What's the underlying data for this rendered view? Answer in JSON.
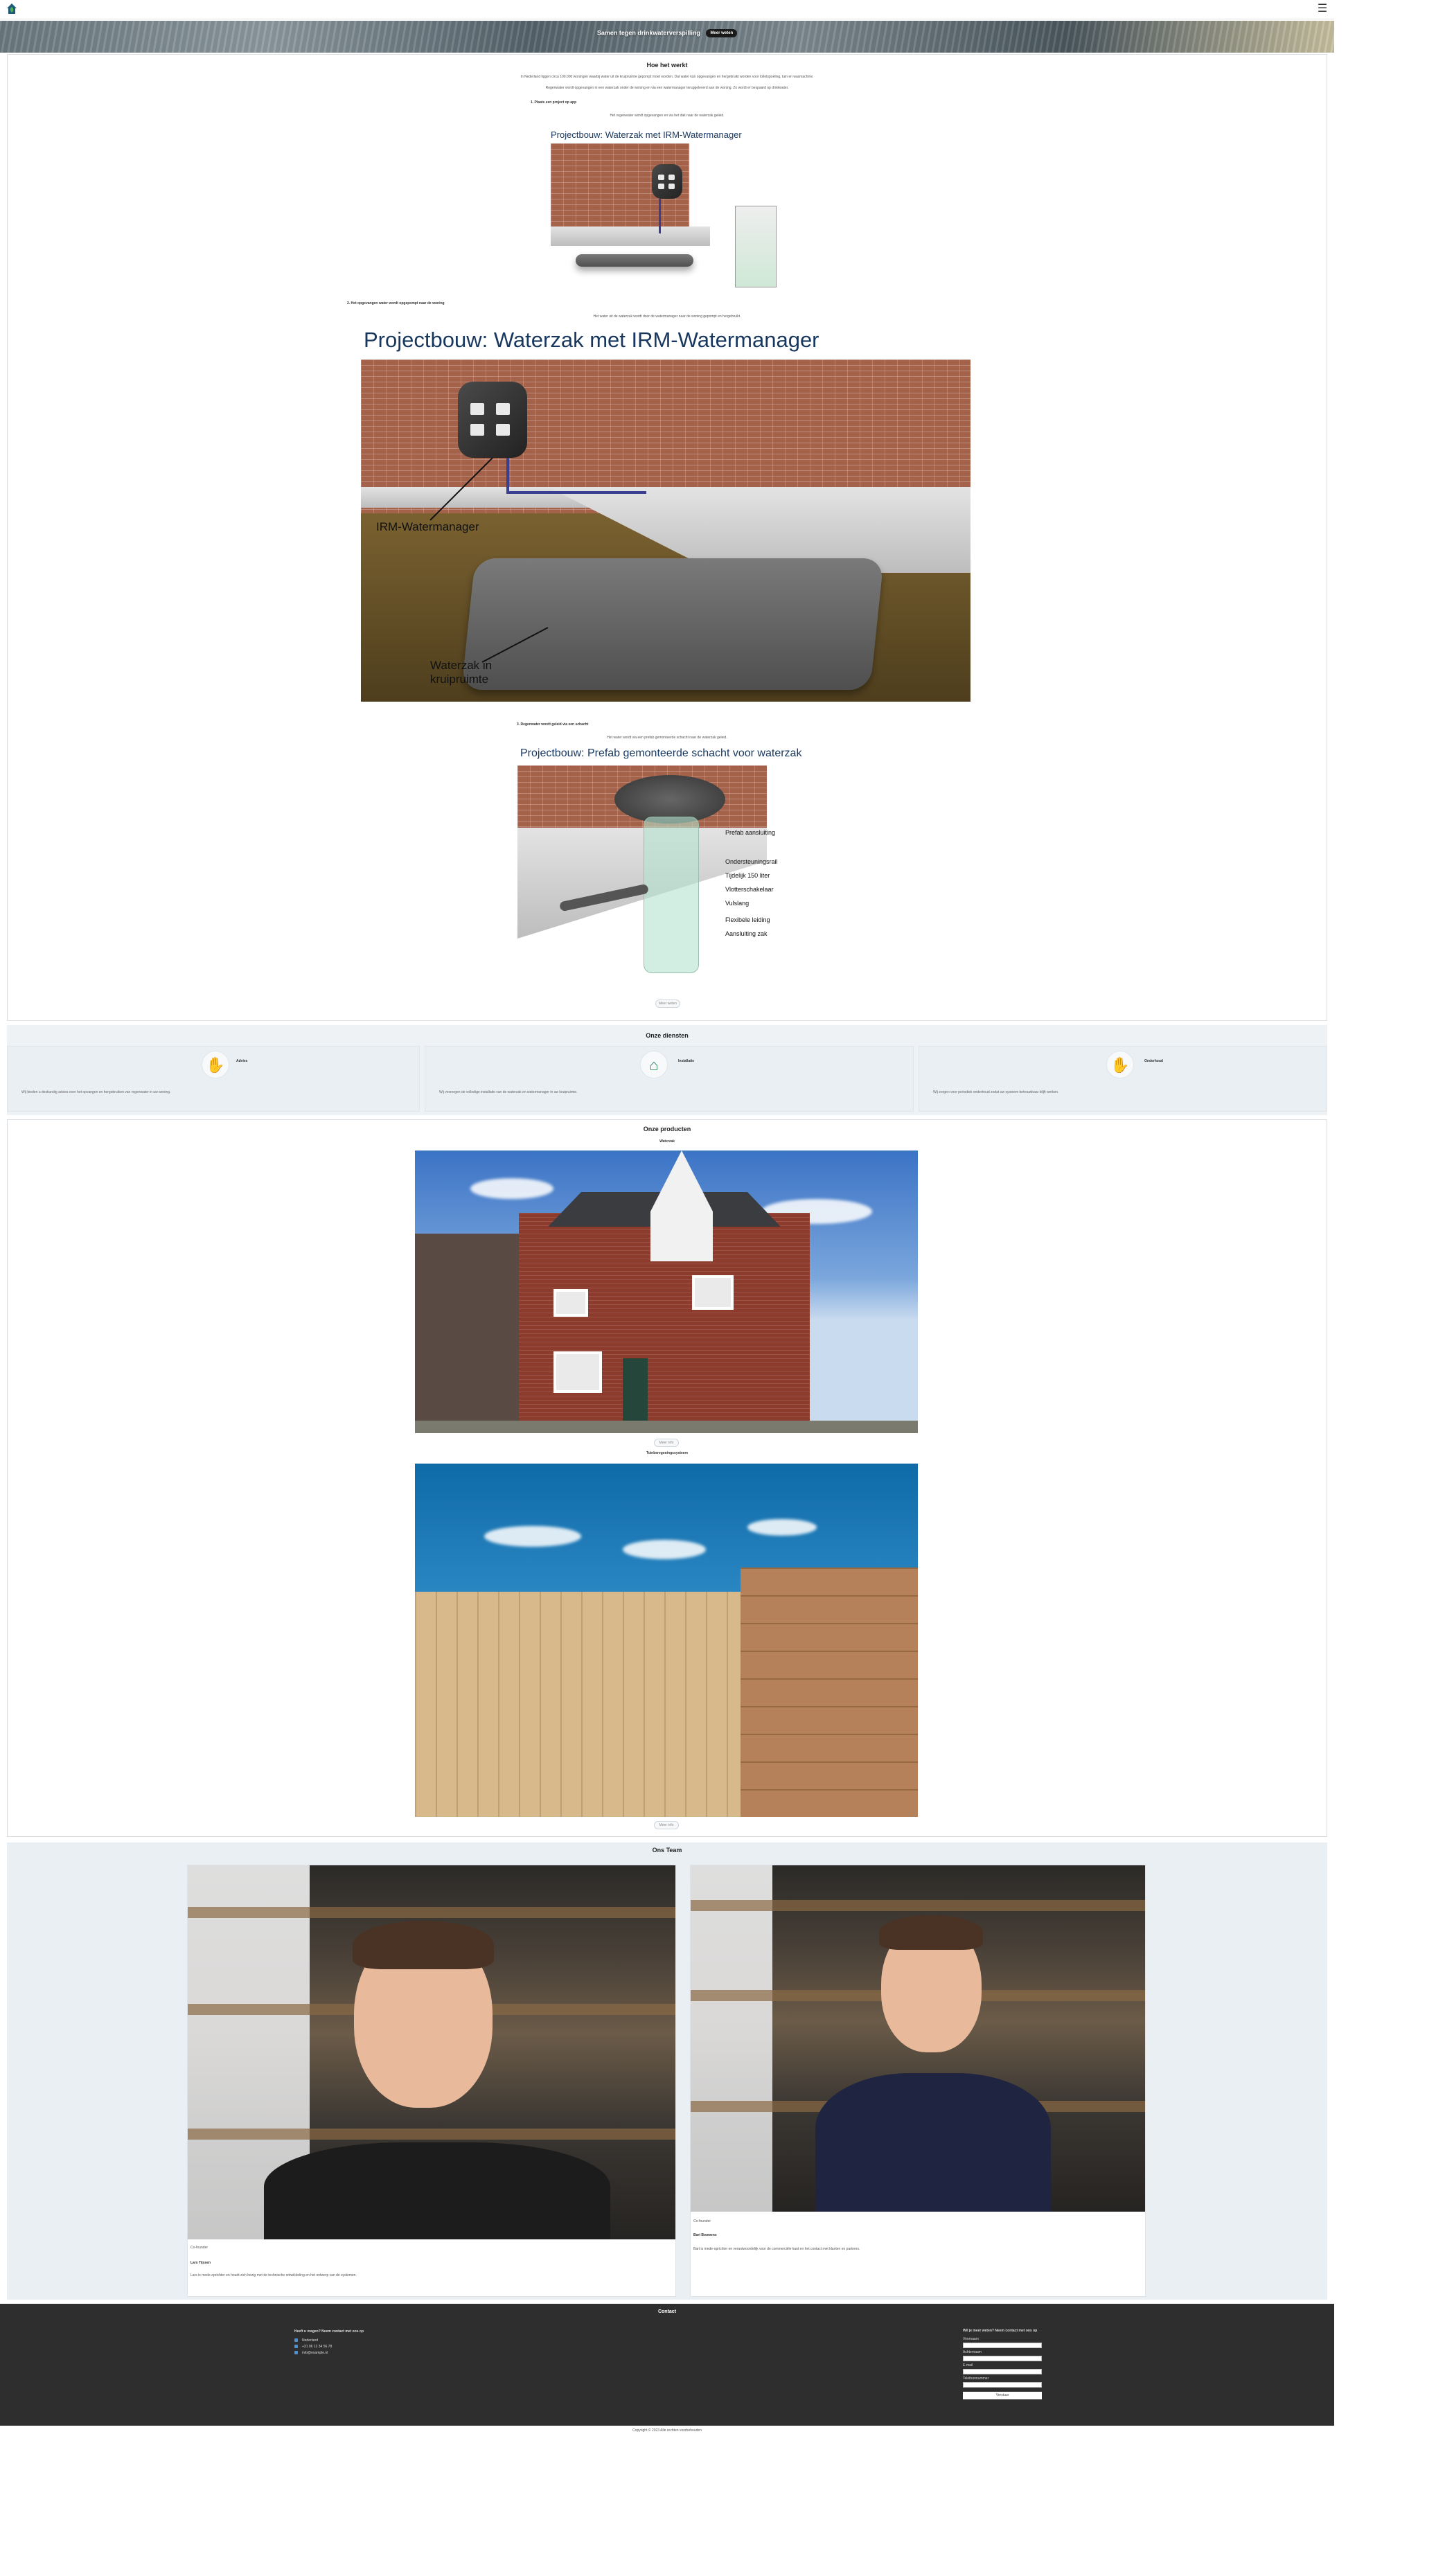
{
  "header": {
    "logo_icon": "house-leaf-logo-icon",
    "menu_icon": "hamburger-menu-icon",
    "menu_glyph": "☰"
  },
  "hero": {
    "title": "Samen tegen drinkwaterverspilling",
    "button": "Meer weten"
  },
  "how": {
    "title": "Hoe het werkt",
    "intro_1": "In Nederland liggen circa 100.000 woningen waarbij water uit de kruipruimte gepompt moet worden. Dat water kan opgevangen en hergebruikt worden voor toiletspoeling, tuin en wasmachine.",
    "intro_2": "Regenwater wordt opgevangen in een waterzak onder de woning en via een watermanager teruggeleverd aan de woning. Zo wordt er bespaard op drinkwater.",
    "step_1": "1. Plaats een project op app",
    "step_1_text": "Het regenwater wordt opgevangen en via het dak naar de waterzak geleid.",
    "illus_1_title": "Projectbouw: Waterzak met IRM-Watermanager",
    "step_2": "2. Het opgevangen water wordt opgepompt naar de woning",
    "step_2_text": "Het water uit de waterzak wordt door de watermanager naar de woning gepompt en hergebruikt.",
    "illus_2_title": "Projectbouw: Waterzak met IRM-Watermanager",
    "illus_2_label_manager": "IRM-Watermanager",
    "illus_2_label_bag_1": "Waterzak in",
    "illus_2_label_bag_2": "kruipruimte",
    "step_3": "3. Regenwater wordt geleid via een schacht",
    "step_3_text": "Het water wordt via een prefab gemonteerde schacht naar de waterzak geleid.",
    "illus_3_title": "Projectbouw: Prefab gemonteerde schacht voor waterzak",
    "illus_3_labels": [
      "Prefab aansluiting",
      "Ondersteuningsrail",
      "Tijdelijk 150 liter",
      "Vlotterschakelaar",
      "Vulslang",
      "Flexibele leiding",
      "Aansluiting zak"
    ],
    "more_button": "Meer weten"
  },
  "diensten": {
    "title": "Onze diensten",
    "cards": [
      {
        "icon": "hand-water-icon",
        "glyph": "✋",
        "title": "Advies",
        "text": "Wij bieden u deskundig advies over het opvangen en hergebruiken van regenwater in uw woning."
      },
      {
        "icon": "house-icon",
        "glyph": "⌂",
        "title": "Installatie",
        "text": "Wij verzorgen de volledige installatie van de waterzak en watermanager in uw kruipruimte."
      },
      {
        "icon": "hand-care-icon",
        "glyph": "✋",
        "title": "Onderhoud",
        "text": "Wij zorgen voor periodiek onderhoud zodat uw systeem betrouwbaar blijft werken."
      }
    ]
  },
  "producten": {
    "title": "Onze producten",
    "items": [
      {
        "title": "Waterzak",
        "button": "Meer info"
      },
      {
        "title": "Tuinberegeningssysteem",
        "button": "Meer info"
      }
    ]
  },
  "team": {
    "title": "Ons Team",
    "members": [
      {
        "role": "Co-founder",
        "name": "Lars Tijssen",
        "bio": "Lars is mede-oprichter en houdt zich bezig met de technische ontwikkeling en het ontwerp van de systemen."
      },
      {
        "role": "Co-founder",
        "name": "Bart Bouwens",
        "bio": "Bart is mede-oprichter en verantwoordelijk voor de commerciële kant en het contact met klanten en partners."
      }
    ]
  },
  "footer": {
    "title": "Contact",
    "contact_heading": "Heeft u vragen? Neem contact met ons op",
    "contact_lines": [
      "Nederland",
      "+31 06 12 34 56 78",
      "info@example.nl"
    ],
    "form_heading": "Wil je meer weten? Neem contact met ons op",
    "fields": [
      "Voornaam",
      "Achternaam",
      "E-mail",
      "Telefoonnummer"
    ],
    "submit": "Verstuur"
  },
  "copyright": "Copyright © 2023 Alle rechten voorbehouden"
}
